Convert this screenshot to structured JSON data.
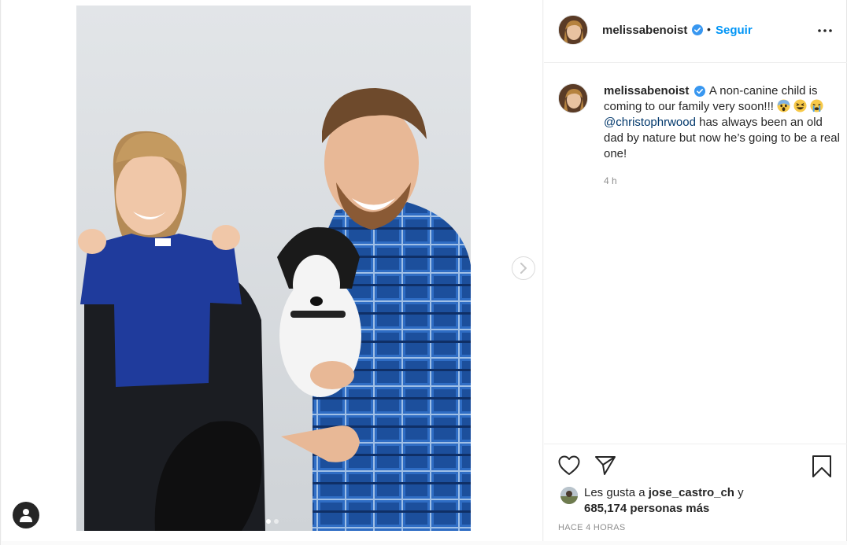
{
  "post": {
    "username": "melissabenoist",
    "follow_label": "Seguir",
    "bullet": "•",
    "caption_text_1": "A non-canine child is coming to our family very soon!!!",
    "mention": "@christophrwood",
    "caption_text_2": "has always been an old dad by nature but now he’s going to be a real one!",
    "relative_time": "4 h",
    "likes_prefix": "Les gusta a",
    "likes_user": "jose_castro_ch",
    "likes_conj": "y",
    "likes_count": "685,174 personas más",
    "post_time": "HACE 4 HORAS"
  },
  "carousel": {
    "slide": 1,
    "total": 2
  },
  "icons": {
    "verified": "verified-badge-icon",
    "more": "more-options-icon",
    "like": "heart-icon",
    "share": "paper-plane-icon",
    "save": "bookmark-icon",
    "next": "chevron-right-icon",
    "user": "user-icon"
  },
  "colors": {
    "accent": "#0095f6",
    "verified": "#3897f0",
    "mention": "#00376b",
    "muted": "#8e8e8e"
  }
}
